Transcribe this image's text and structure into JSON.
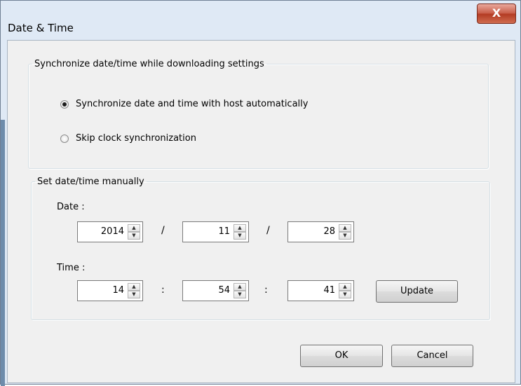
{
  "window": {
    "title": "Date & Time",
    "close_label": "X"
  },
  "sync_group": {
    "legend": "Synchronize date/time while downloading settings",
    "options": [
      {
        "label": "Synchronize date and time with host automatically",
        "checked": true
      },
      {
        "label": "Skip clock synchronization",
        "checked": false
      }
    ]
  },
  "manual_group": {
    "legend": "Set date/time manually",
    "date_label": "Date :",
    "date": {
      "year": "2014",
      "month": "11",
      "day": "28",
      "separator": "/"
    },
    "time_label": "Time :",
    "time": {
      "hour": "14",
      "minute": "54",
      "second": "41",
      "separator": ":"
    },
    "update_label": "Update"
  },
  "buttons": {
    "ok": "OK",
    "cancel": "Cancel"
  }
}
